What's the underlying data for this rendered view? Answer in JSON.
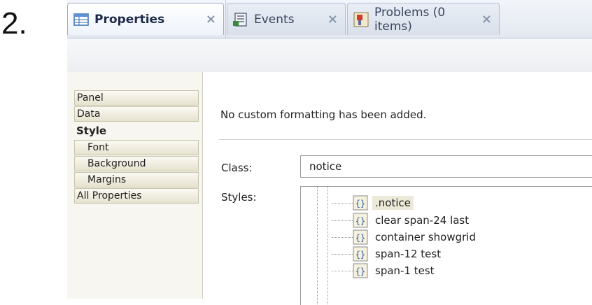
{
  "step": {
    "number": "2."
  },
  "tabs": [
    {
      "label": "Properties",
      "icon": "properties-table-icon",
      "active": true
    },
    {
      "label": "Events",
      "icon": "events-list-icon",
      "active": false
    },
    {
      "label": "Problems (0 items)",
      "icon": "problems-icon",
      "active": false
    }
  ],
  "tab_close_glyph": "×",
  "categories": [
    {
      "label": "Panel",
      "kind": "raised"
    },
    {
      "label": "Data",
      "kind": "raised"
    },
    {
      "label": "Style",
      "kind": "selected"
    },
    {
      "label": "Font",
      "kind": "sub"
    },
    {
      "label": "Background",
      "kind": "sub"
    },
    {
      "label": "Margins",
      "kind": "sub"
    },
    {
      "label": "All Properties",
      "kind": "raised"
    }
  ],
  "content": {
    "message": "No custom formatting has been added.",
    "class_label": "Class:",
    "class_value": "notice",
    "styles_label": "Styles:",
    "style_rules": [
      {
        "label": ".notice",
        "selected": true
      },
      {
        "label": "clear span-24 last",
        "selected": false
      },
      {
        "label": "container showgrid",
        "selected": false
      },
      {
        "label": "span-12 test",
        "selected": false
      },
      {
        "label": "span-1 test",
        "selected": false
      }
    ]
  },
  "colors": {
    "tab_text": "#1d2a4a",
    "close_glyph": "#8a96aa",
    "panel_bg": "#f7f6f0",
    "selected_rule_bg": "#ece9d8"
  }
}
